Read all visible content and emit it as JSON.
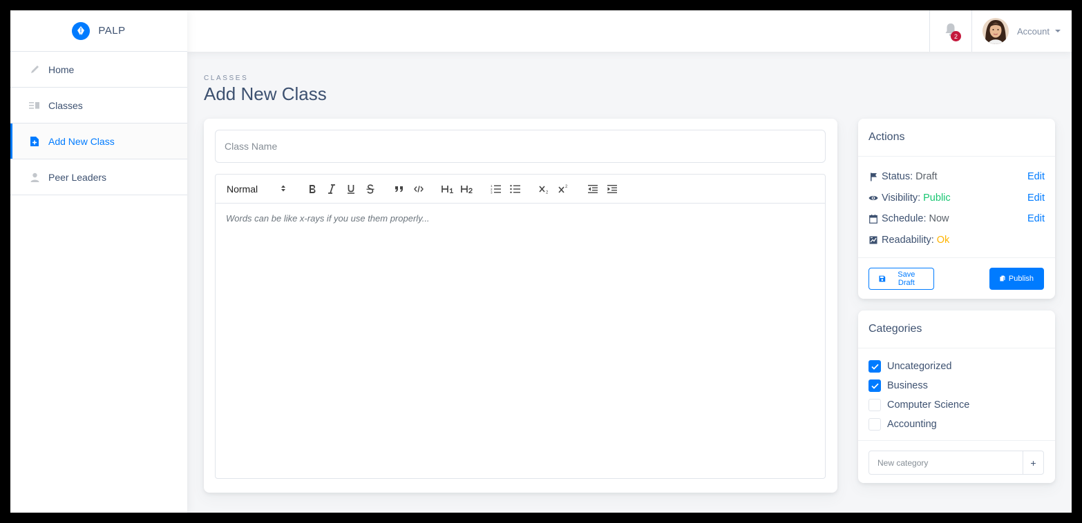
{
  "brand": {
    "name": "PALP",
    "logo_icon": "feather-icon",
    "accent": "#007bff"
  },
  "sidebar": {
    "items": [
      {
        "label": "Home",
        "icon": "pencil-icon",
        "active": false
      },
      {
        "label": "Classes",
        "icon": "list-icon",
        "active": false
      },
      {
        "label": "Add New Class",
        "icon": "file-plus-icon",
        "active": true
      },
      {
        "label": "Peer Leaders",
        "icon": "person-icon",
        "active": false
      }
    ]
  },
  "topbar": {
    "notifications_count": "2",
    "account_label": "Account"
  },
  "page": {
    "subtitle": "Classes",
    "title": "Add New Class"
  },
  "editor": {
    "class_name_placeholder": "Class Name",
    "format_select": "Normal",
    "body_placeholder": "Words can be like x-rays if you use them properly...",
    "toolbar_buttons": [
      "bold",
      "italic",
      "underline",
      "strike",
      "blockquote",
      "code",
      "h1",
      "h2",
      "ordered-list",
      "bullet-list",
      "subscript",
      "superscript",
      "outdent",
      "indent"
    ]
  },
  "actions": {
    "title": "Actions",
    "status_label": "Status:",
    "status_value": "Draft",
    "visibility_label": "Visibility:",
    "visibility_value": "Public",
    "schedule_label": "Schedule:",
    "schedule_value": "Now",
    "readability_label": "Readability:",
    "readability_value": "Ok",
    "edit_label": "Edit",
    "save_draft": "Save Draft",
    "publish": "Publish",
    "colors": {
      "public": "#17c671",
      "ok": "#ffb400",
      "link": "#007bff"
    }
  },
  "categories": {
    "title": "Categories",
    "items": [
      {
        "label": "Uncategorized",
        "checked": true
      },
      {
        "label": "Business",
        "checked": true
      },
      {
        "label": "Computer Science",
        "checked": false
      },
      {
        "label": "Accounting",
        "checked": false
      }
    ],
    "new_placeholder": "New category",
    "add_label": "+"
  }
}
